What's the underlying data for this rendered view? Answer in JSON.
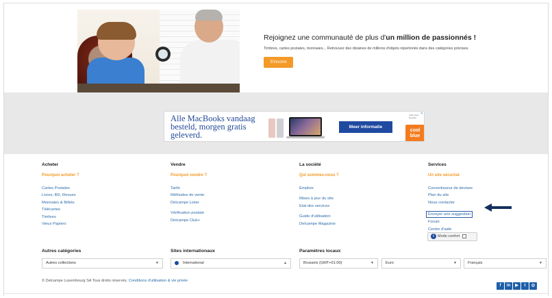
{
  "hero": {
    "title_prefix": "Rejoignez une communauté de plus d'",
    "title_bold": "un million de passionnés !",
    "description": "Timbres, cartes postales, monnaies... Retrouvez des dizaines de millions d'objets répertoriés dans des catégories précises.",
    "signup_button": "S'inscrire"
  },
  "ad": {
    "lines": [
      "Alle MacBooks vandaag",
      "besteld, morgen gratis",
      "geleverd."
    ],
    "cta": "Meer informatie",
    "partner": "Authorised Reseller",
    "logo_line1": "cool",
    "logo_line2": "blue",
    "close": "✕"
  },
  "footer": {
    "columns": [
      {
        "title": "Acheter",
        "highlight": "Pourquoi acheter ?",
        "links": [
          "Cartes Postales",
          "Livres, BD, Revues",
          "Monnaies & Billets",
          "Télécartes",
          "Timbres",
          "Vieux Papiers"
        ]
      },
      {
        "title": "Vendre",
        "highlight": "Pourquoi vendre ?",
        "links": [
          "Tarifs",
          "Méthodes de vente",
          "Delcampe Lister",
          "Vérification postale",
          "Delcampe Club+"
        ]
      },
      {
        "title": "La société",
        "highlight": "Qui sommes-nous ?",
        "links": [
          "Emplois",
          "Mises à jour du site",
          "Etat des services",
          "Guide d'utilisation",
          "Delcampe Magazine"
        ]
      },
      {
        "title": "Services",
        "highlight": "Un site sécurisé",
        "links": [
          "Convertisseur de devises",
          "Plan du site",
          "Nous contacter",
          "Envoyer une suggestion",
          "Forum",
          "Centre d'aide"
        ]
      }
    ],
    "mode_confort": "Mode confort",
    "mode_confort_icon": "i"
  },
  "selects": {
    "autres_categories": {
      "label": "Autres catégories",
      "value": "Autres collections"
    },
    "sites_internationaux": {
      "label": "Sites internationaux",
      "value": "International"
    },
    "parametres_locaux": {
      "label": "Paramètres locaux",
      "timezone": "Brussels (GMT+01:00)",
      "currency": "Euro",
      "language": "Français"
    }
  },
  "copyright": {
    "text": "© Delcampe Luxembourg SA Tous droits réservés.",
    "link": "Conditions d'utilisation & vie privée"
  },
  "socials": [
    {
      "icon": "facebook-icon",
      "glyph": "f"
    },
    {
      "icon": "linkedin-icon",
      "glyph": "in"
    },
    {
      "icon": "youtube-icon",
      "glyph": "▶"
    },
    {
      "icon": "twitter-icon",
      "glyph": "t"
    },
    {
      "icon": "instagram-icon",
      "glyph": "◎"
    }
  ],
  "colors": {
    "accent_orange": "#f39a28",
    "link_blue": "#2a6aa8",
    "brand_blue": "#1f4aa0",
    "arrow_navy": "#14305f"
  }
}
